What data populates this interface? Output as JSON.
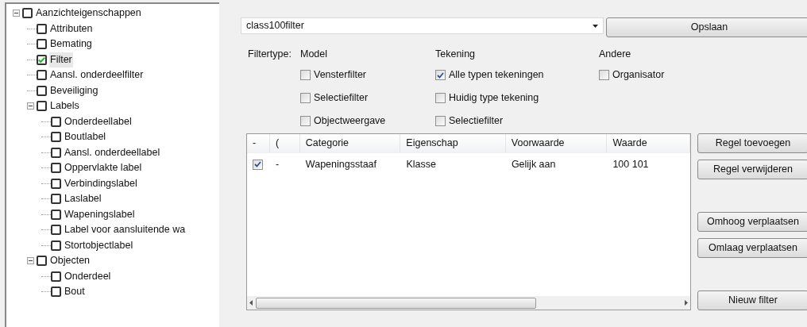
{
  "tree": [
    {
      "label": "Aanzichteigenschappen",
      "checked": false,
      "selected": false,
      "expanded": true,
      "children": [
        {
          "label": "Attributen",
          "checked": false,
          "selected": false
        },
        {
          "label": "Bemating",
          "checked": false,
          "selected": false
        },
        {
          "label": "Filter",
          "checked": true,
          "selected": true
        },
        {
          "label": "Aansl. onderdeelfilter",
          "checked": false,
          "selected": false
        },
        {
          "label": "Beveiliging",
          "checked": false,
          "selected": false
        },
        {
          "label": "Labels",
          "checked": false,
          "selected": false,
          "expanded": true,
          "children": [
            {
              "label": "Onderdeellabel",
              "checked": false,
              "selected": false
            },
            {
              "label": "Boutlabel",
              "checked": false,
              "selected": false
            },
            {
              "label": "Aansl. onderdeellabel",
              "checked": false,
              "selected": false
            },
            {
              "label": "Oppervlakte label",
              "checked": false,
              "selected": false
            },
            {
              "label": "Verbindingslabel",
              "checked": false,
              "selected": false
            },
            {
              "label": "Laslabel",
              "checked": false,
              "selected": false
            },
            {
              "label": "Wapeningslabel",
              "checked": false,
              "selected": false
            },
            {
              "label": "Label voor aansluitende wa",
              "checked": false,
              "selected": false
            },
            {
              "label": "Stortobjectlabel",
              "checked": false,
              "selected": false
            }
          ]
        },
        {
          "label": "Objecten",
          "checked": false,
          "selected": false,
          "expanded": true,
          "children": [
            {
              "label": "Onderdeel",
              "checked": false,
              "selected": false
            },
            {
              "label": "Bout",
              "checked": false,
              "selected": false
            }
          ]
        }
      ]
    }
  ],
  "filter_select": {
    "value": "class100filter"
  },
  "save_button": "Opslaan",
  "filtertype_label": "Filtertype:",
  "groups": [
    {
      "heading": "Model",
      "options": [
        {
          "label": "Vensterfilter",
          "checked": false
        },
        {
          "label": "Selectiefilter",
          "checked": false
        },
        {
          "label": "Objectweergave",
          "checked": false
        }
      ]
    },
    {
      "heading": "Tekening",
      "options": [
        {
          "label": "Alle typen tekeningen",
          "checked": true
        },
        {
          "label": "Huidig type tekening",
          "checked": false
        },
        {
          "label": "Selectiefilter",
          "checked": false
        }
      ]
    },
    {
      "heading": "Andere",
      "options": [
        {
          "label": "Organisator",
          "checked": false
        }
      ]
    }
  ],
  "table": {
    "columns": [
      "-",
      "(",
      "Categorie",
      "Eigenschap",
      "Voorwaarde",
      "Waarde"
    ],
    "rows": [
      {
        "checked": true,
        "cells": [
          "",
          "-",
          "Wapeningsstaaf",
          "Klasse",
          "Gelijk aan",
          "100 101"
        ]
      }
    ]
  },
  "button_groups": [
    [
      "Regel toevoegen",
      "Regel verwijderen"
    ],
    [
      "Omhoog verplaatsen",
      "Omlaag verplaatsen"
    ],
    [
      "Nieuw filter"
    ]
  ]
}
